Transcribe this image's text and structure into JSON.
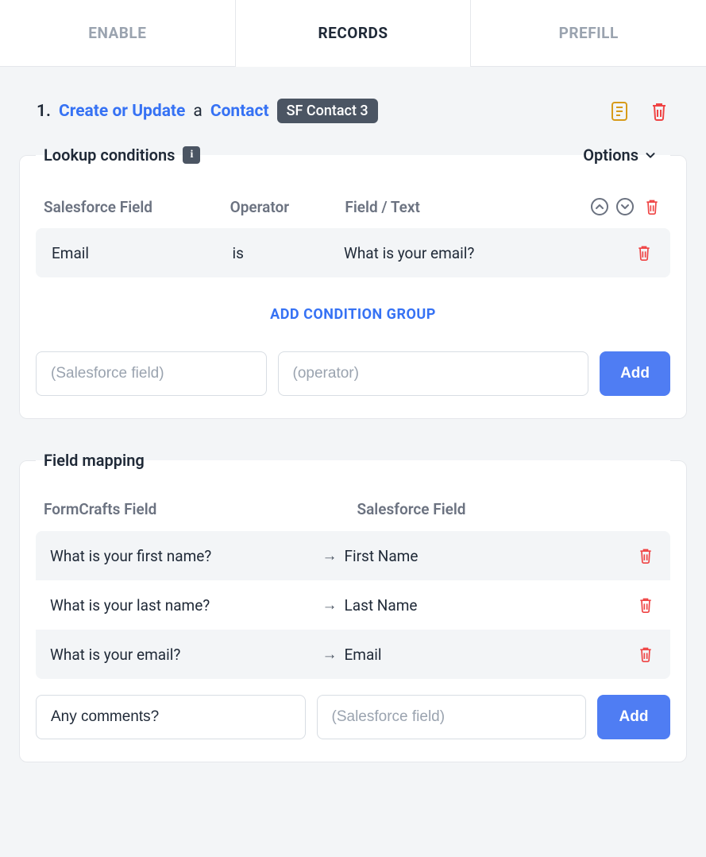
{
  "tabs": {
    "enable": "ENABLE",
    "records": "RECORDS",
    "prefill": "PREFILL",
    "active": "records"
  },
  "record": {
    "index": "1.",
    "action": "Create or Update",
    "joiner": "a",
    "object": "Contact",
    "badge": "SF Contact 3"
  },
  "lookup": {
    "title": "Lookup conditions",
    "options_label": "Options",
    "headers": {
      "field": "Salesforce Field",
      "operator": "Operator",
      "value": "Field / Text"
    },
    "rows": [
      {
        "field": "Email",
        "operator": "is",
        "value": "What is your email?"
      }
    ],
    "add_group_label": "ADD CONDITION GROUP",
    "new": {
      "field_placeholder": "(Salesforce field)",
      "operator_placeholder": "(operator)",
      "add_label": "Add"
    }
  },
  "mapping": {
    "title": "Field mapping",
    "headers": {
      "form": "FormCrafts Field",
      "sf": "Salesforce Field"
    },
    "rows": [
      {
        "form": "What is your first name?",
        "sf": "First Name"
      },
      {
        "form": "What is your last name?",
        "sf": "Last Name"
      },
      {
        "form": "What is your email?",
        "sf": "Email"
      }
    ],
    "new": {
      "form_value": "Any comments?",
      "sf_placeholder": "(Salesforce field)",
      "add_label": "Add"
    }
  },
  "icons": {
    "note": "note-icon",
    "trash": "trash-icon",
    "info": "i",
    "arrow": "→"
  }
}
